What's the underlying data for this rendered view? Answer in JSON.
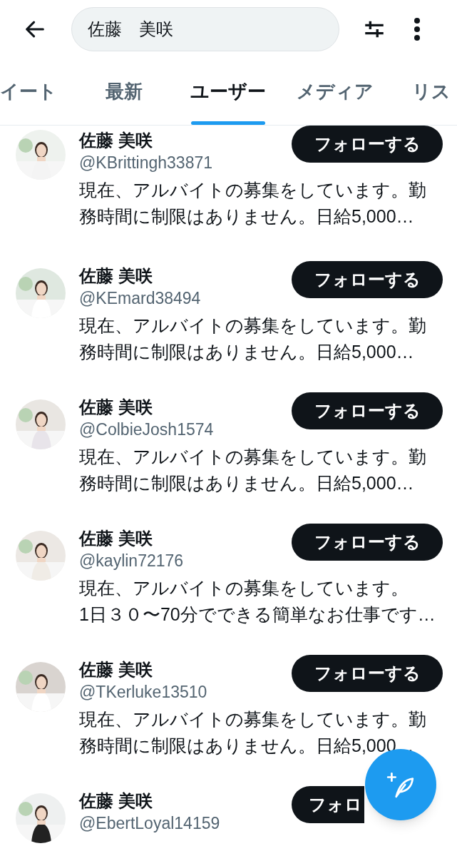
{
  "search": {
    "value": "佐藤　美咲"
  },
  "tabs": [
    {
      "label": "イート",
      "selected": false
    },
    {
      "label": "最新",
      "selected": false
    },
    {
      "label": "ユーザー",
      "selected": true
    },
    {
      "label": "メディア",
      "selected": false
    },
    {
      "label": "リス",
      "selected": false
    }
  ],
  "users": [
    {
      "name": "佐藤 美咲",
      "handle": "@KBrittingh33871",
      "bio_lines": [
        "現在、アルバイトの募集をしています。勤",
        "務時間に制限はありません。日給5,000…"
      ],
      "button": "フォローする"
    },
    {
      "name": "佐藤 美咲",
      "handle": "@KEmard38494",
      "bio_lines": [
        "現在、アルバイトの募集をしています。勤",
        "務時間に制限はありません。日給5,000…"
      ],
      "button": "フォローする"
    },
    {
      "name": "佐藤 美咲",
      "handle": "@ColbieJosh1574",
      "bio_lines": [
        "現在、アルバイトの募集をしています。勤",
        "務時間に制限はありません。日給5,000…"
      ],
      "button": "フォローする"
    },
    {
      "name": "佐藤 美咲",
      "handle": "@kaylin72176",
      "bio_lines": [
        "現在、アルバイトの募集をしています。",
        "1日３０〜70分でできる簡単なお仕事です…"
      ],
      "button": "フォローする"
    },
    {
      "name": "佐藤 美咲",
      "handle": "@TKerluke13510",
      "bio_lines": [
        "現在、アルバイトの募集をしています。勤",
        "務時間に制限はありません。日給5,000…"
      ],
      "button": "フォローする"
    },
    {
      "name": "佐藤 美咲",
      "handle": "@EbertLoyal14159",
      "button": "フォロ",
      "button_cut": true
    }
  ]
}
